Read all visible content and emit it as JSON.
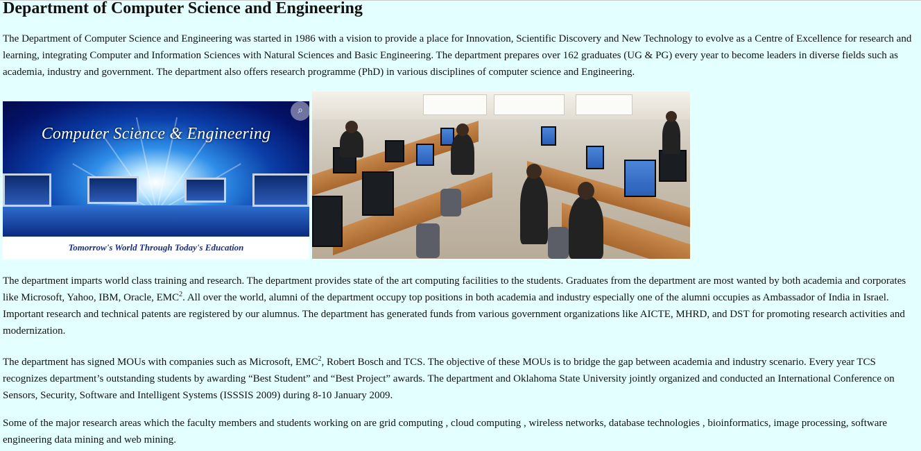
{
  "page": {
    "title": "Department of Computer Science and Engineering",
    "intro": "The Department of Computer Science and Engineering was started in 1986 with a vision to provide a place for Innovation, Scientific Discovery and New Technology to evolve as a Centre of Excellence for research and learning, integrating Computer and Information Sciences with Natural Sciences and Basic Engineering. The department prepares over 162 graduates (UG & PG) every year to become leaders in diverse fields such as academia, industry and government. The department also offers research programme (PhD) in various disciplines of computer science and Engineering.",
    "banner": {
      "title": "Computer Science & Engineering",
      "tagline": "Tomorrow's World Through  Today's   Education",
      "lens_icon": "lens-search-icon"
    },
    "lab_photo": {
      "description_icon": "computer-lab-photo"
    },
    "para2": {
      "part1": "The department imparts world class training and research. The department provides state of the art computing facilities to the students. Graduates from the department are most wanted by both academia and corporates like Microsoft, Yahoo, IBM, Oracle, EMC",
      "sup": "2",
      "part2": ". All over the world, alumni of the department occupy top positions in both academia and industry especially one of the alumni occupies as Ambassador of India in Israel. Important research and technical patents are registered by our alumnus. The department has generated funds from various government organizations like AICTE, MHRD, and DST for promoting research activities and modernization."
    },
    "para3": {
      "part1": "The department has signed MOUs with companies such as Microsoft, EMC",
      "sup": "2",
      "part2": ", Robert Bosch and TCS. The objective of these MOUs is to bridge the gap between academia and industry scenario. Every year TCS recognizes department’s outstanding students by awarding “Best Student” and “Best Project” awards. The department and Oklahoma State University jointly organized and conducted an International Conference on Sensors, Security, Software and Intelligent Systems (ISSSIS 2009) during 8-10 January 2009."
    },
    "para4": "Some of the major research areas which the faculty members and students working on are grid computing , cloud computing , wireless networks, database technologies , bioinformatics, image processing, software engineering data mining and web mining."
  },
  "colors": {
    "background": "#e3ffff",
    "text": "#111111",
    "banner_blue": "#0a3ea8"
  }
}
